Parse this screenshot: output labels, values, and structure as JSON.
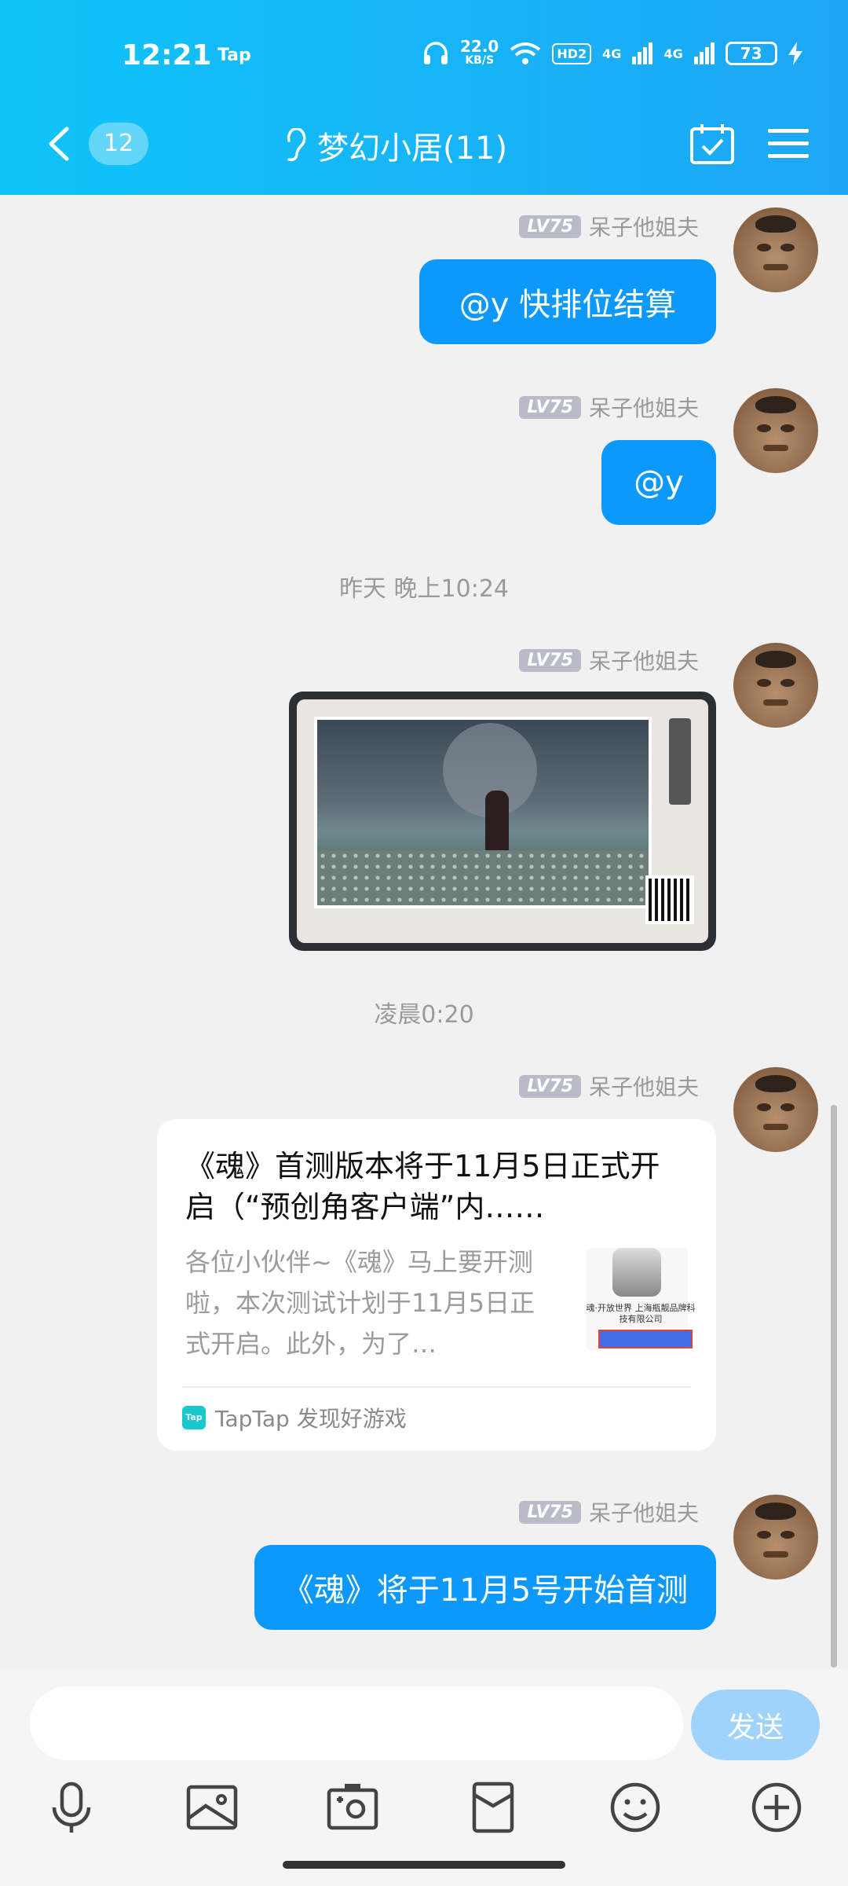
{
  "status_bar": {
    "time": "12:21",
    "app_indicator": "Tap",
    "net_speed": "22.0",
    "net_unit": "KB/S",
    "hd": "HD2",
    "signal1": "4G",
    "signal2": "4G",
    "battery": "73"
  },
  "header": {
    "unread_count": "12",
    "title": "梦幻小居(11)"
  },
  "messages": [
    {
      "type": "text",
      "level": "LV75",
      "sender": "呆子他姐夫",
      "text": "@y 快排位结算"
    },
    {
      "type": "text",
      "level": "LV75",
      "sender": "呆子他姐夫",
      "text": "@y"
    },
    {
      "type": "timestamp",
      "text": "昨天 晚上10:24"
    },
    {
      "type": "image",
      "level": "LV75",
      "sender": "呆子他姐夫"
    },
    {
      "type": "timestamp",
      "text": "凌晨0:20"
    },
    {
      "type": "card",
      "level": "LV75",
      "sender": "呆子他姐夫",
      "title": "《魂》首测版本将于11月5日正式开启（“预创角客户端”内……",
      "description": "各位小伙伴~《魂》马上要开测啦，本次测试计划于11月5日正式开启。此外，为了…",
      "thumb_text": "魂·开放世界 上海瓶靓品牌科技有限公司",
      "source": "TapTap 发现好游戏",
      "source_logo": "Tap"
    },
    {
      "type": "text",
      "level": "LV75",
      "sender": "呆子他姐夫",
      "text": "《魂》将于11月5号开始首测"
    }
  ],
  "input": {
    "placeholder": "",
    "send_label": "发送"
  },
  "colors": {
    "header": "#1ea6f6",
    "bubble": "#0d99fb",
    "send_disabled": "#9fd3fb"
  }
}
